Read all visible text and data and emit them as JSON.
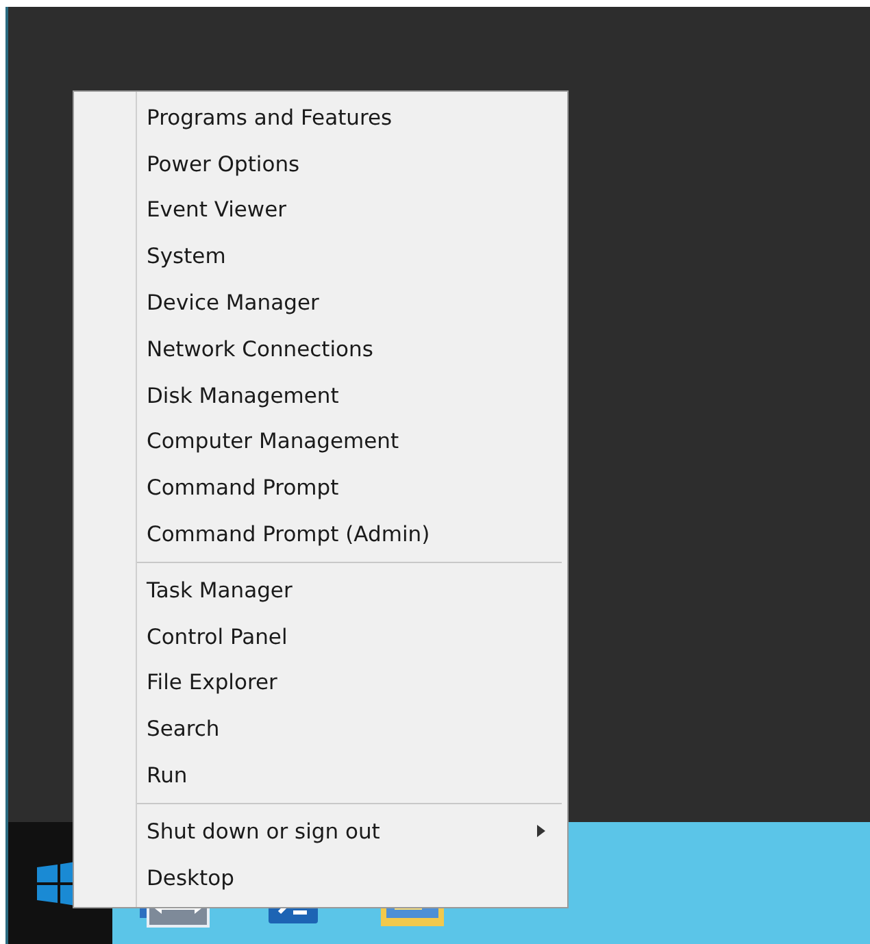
{
  "menu": {
    "groups": [
      {
        "items": [
          {
            "label": "Programs and Features"
          },
          {
            "label": "Power Options"
          },
          {
            "label": "Event Viewer"
          },
          {
            "label": "System"
          },
          {
            "label": "Device Manager"
          },
          {
            "label": "Network Connections"
          },
          {
            "label": "Disk Management"
          },
          {
            "label": "Computer Management"
          },
          {
            "label": "Command Prompt"
          },
          {
            "label": "Command Prompt (Admin)"
          }
        ]
      },
      {
        "items": [
          {
            "label": "Task Manager"
          },
          {
            "label": "Control Panel"
          },
          {
            "label": "File Explorer"
          },
          {
            "label": "Search"
          },
          {
            "label": "Run"
          }
        ]
      },
      {
        "items": [
          {
            "label": "Shut down or sign out",
            "submenu": true
          },
          {
            "label": "Desktop"
          }
        ]
      }
    ]
  },
  "taskbar": {
    "apps": [
      {
        "kind": "server"
      },
      {
        "kind": "terminal"
      },
      {
        "kind": "folder"
      }
    ]
  }
}
